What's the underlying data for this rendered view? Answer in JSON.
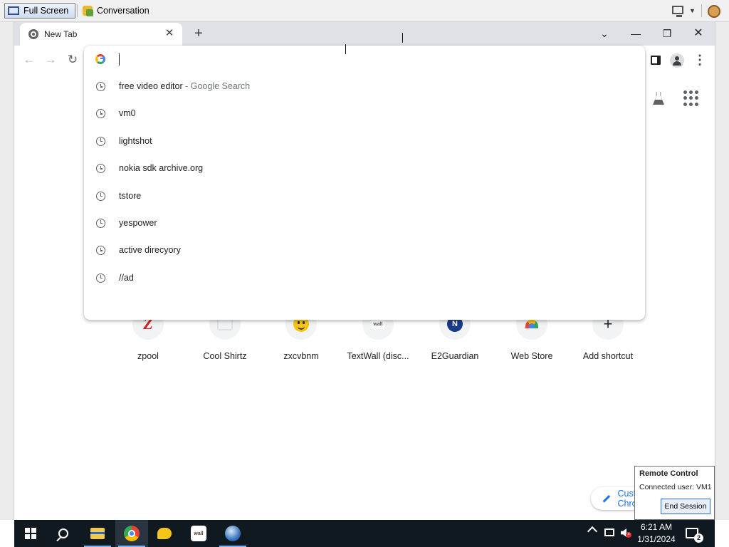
{
  "viewer": {
    "full_screen_label": "Full Screen",
    "conversation_label": "Conversation"
  },
  "browser": {
    "tab_title": "New Tab",
    "tab_close": "✕",
    "new_tab": "+",
    "window_controls": {
      "dropdown": "⌄",
      "minimize": "—",
      "restore": "❐",
      "close": "✕"
    },
    "nav": {
      "back": "←",
      "forward": "→",
      "reload": "↻",
      "menu": "⋮"
    }
  },
  "omnibox": {
    "value": "",
    "suggestions": [
      {
        "text": "free video editor",
        "separator": " - ",
        "suffix": "Google Search"
      },
      {
        "text": "vm0",
        "separator": "",
        "suffix": ""
      },
      {
        "text": "lightshot",
        "separator": "",
        "suffix": ""
      },
      {
        "text": "nokia sdk archive.org",
        "separator": "",
        "suffix": ""
      },
      {
        "text": "tstore",
        "separator": "",
        "suffix": ""
      },
      {
        "text": "yespower",
        "separator": "",
        "suffix": ""
      },
      {
        "text": "active direcyory",
        "separator": "",
        "suffix": ""
      },
      {
        "text": "//ad",
        "separator": "",
        "suffix": ""
      }
    ]
  },
  "ntp": {
    "shortcuts": [
      {
        "label": "zpool",
        "icon": "zpool-favicon",
        "glyph": "Z"
      },
      {
        "label": "Cool Shirtz",
        "icon": "cool-shirtz-favicon",
        "glyph": ""
      },
      {
        "label": "zxcvbnm",
        "icon": "smiley-favicon",
        "glyph": ""
      },
      {
        "label": "TextWall (disc...",
        "icon": "textwall-favicon",
        "glyph": "wall"
      },
      {
        "label": "E2Guardian",
        "icon": "e2guardian-favicon",
        "glyph": "N"
      },
      {
        "label": "Web Store",
        "icon": "web-store-favicon",
        "glyph": ""
      },
      {
        "label": "Add shortcut",
        "icon": "plus-icon",
        "glyph": "+"
      }
    ],
    "customize_label": "Customize Chrome"
  },
  "remote_control": {
    "title": "Remote Control",
    "connected_user": "Connected user: VM1",
    "end_session_label": "End Session"
  },
  "taskbar": {
    "time": "6:21 AM",
    "date": "1/31/2024",
    "notification_count": "2",
    "apps": [
      "start-icon",
      "search-icon",
      "file-explorer-icon",
      "chrome-icon",
      "chat-icon",
      "textwall-app-icon",
      "globe-app-icon"
    ],
    "colors": {
      "taskbar_bg": "#101820",
      "accent": "#1a73e8"
    }
  }
}
